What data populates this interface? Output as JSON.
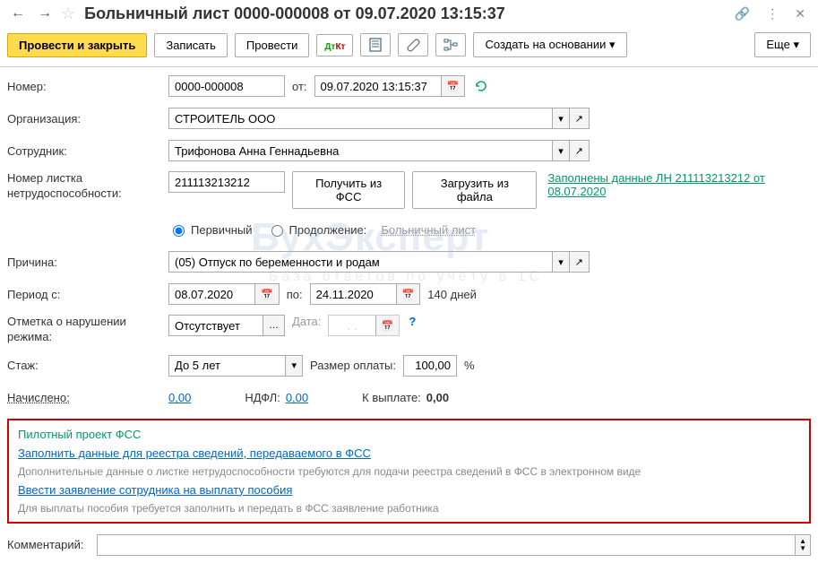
{
  "title": "Больничный лист 0000-000008 от 09.07.2020 13:15:37",
  "toolbar": {
    "post_close": "Провести и закрыть",
    "write": "Записать",
    "post": "Провести",
    "create_based": "Создать на основании",
    "more": "Еще"
  },
  "labels": {
    "number": "Номер:",
    "from": "от:",
    "organization": "Организация:",
    "employee": "Сотрудник:",
    "sheet_number": "Номер листка нетрудоспособности:",
    "get_from_fss": "Получить из ФСС",
    "load_from_file": "Загрузить из файл",
    "reason": "Причина:",
    "period_from": "Период с:",
    "period_to": "по:",
    "days_suffix": "дней",
    "violation": "Отметка о нарушении режима:",
    "date": "Дата:",
    "experience": "Стаж:",
    "pay_rate": "Размер оплаты:",
    "accrued": "Начислено:",
    "ndfl": "НДФЛ:",
    "to_pay": "К выплате:",
    "comment": "Комментарий:",
    "radio_primary": "Первичный",
    "radio_continuation": "Продолжение:",
    "sick_sheet_disabled": "Больничный лист",
    "ln_filled_link": "Заполнены данные ЛН 211113213212 от 08.07.2020"
  },
  "values": {
    "number": "0000-000008",
    "date": "09.07.2020 13:15:37",
    "organization": "СТРОИТЕЛЬ ООО",
    "employee": "Трифонова Анна Геннадьевна",
    "sheet_number": "211113213212",
    "reason": "(05) Отпуск по беременности и родам",
    "period_from": "08.07.2020",
    "period_to": "24.11.2020",
    "days": "140",
    "violation": "Отсутствует",
    "violation_date": ". .",
    "experience": "До 5 лет",
    "pay_rate": "100,00",
    "accrued": "0,00",
    "ndfl": "0,00",
    "to_pay": "0,00",
    "comment": ""
  },
  "fss": {
    "title": "Пилотный проект ФСС",
    "link1": "Заполнить данные для реестра сведений, передаваемого в ФСС",
    "note1": "Дополнительные данные о листке нетрудоспособности требуются для подачи реестра сведений в ФСС в электронном виде",
    "link2": "Ввести заявление сотрудника на выплату пособия",
    "note2": "Для выплаты пособия требуется заполнить и передать в ФСС заявление работника"
  },
  "watermark": {
    "main": "БухЭксперт",
    "sub": "База ответов по учёту в 1С"
  }
}
